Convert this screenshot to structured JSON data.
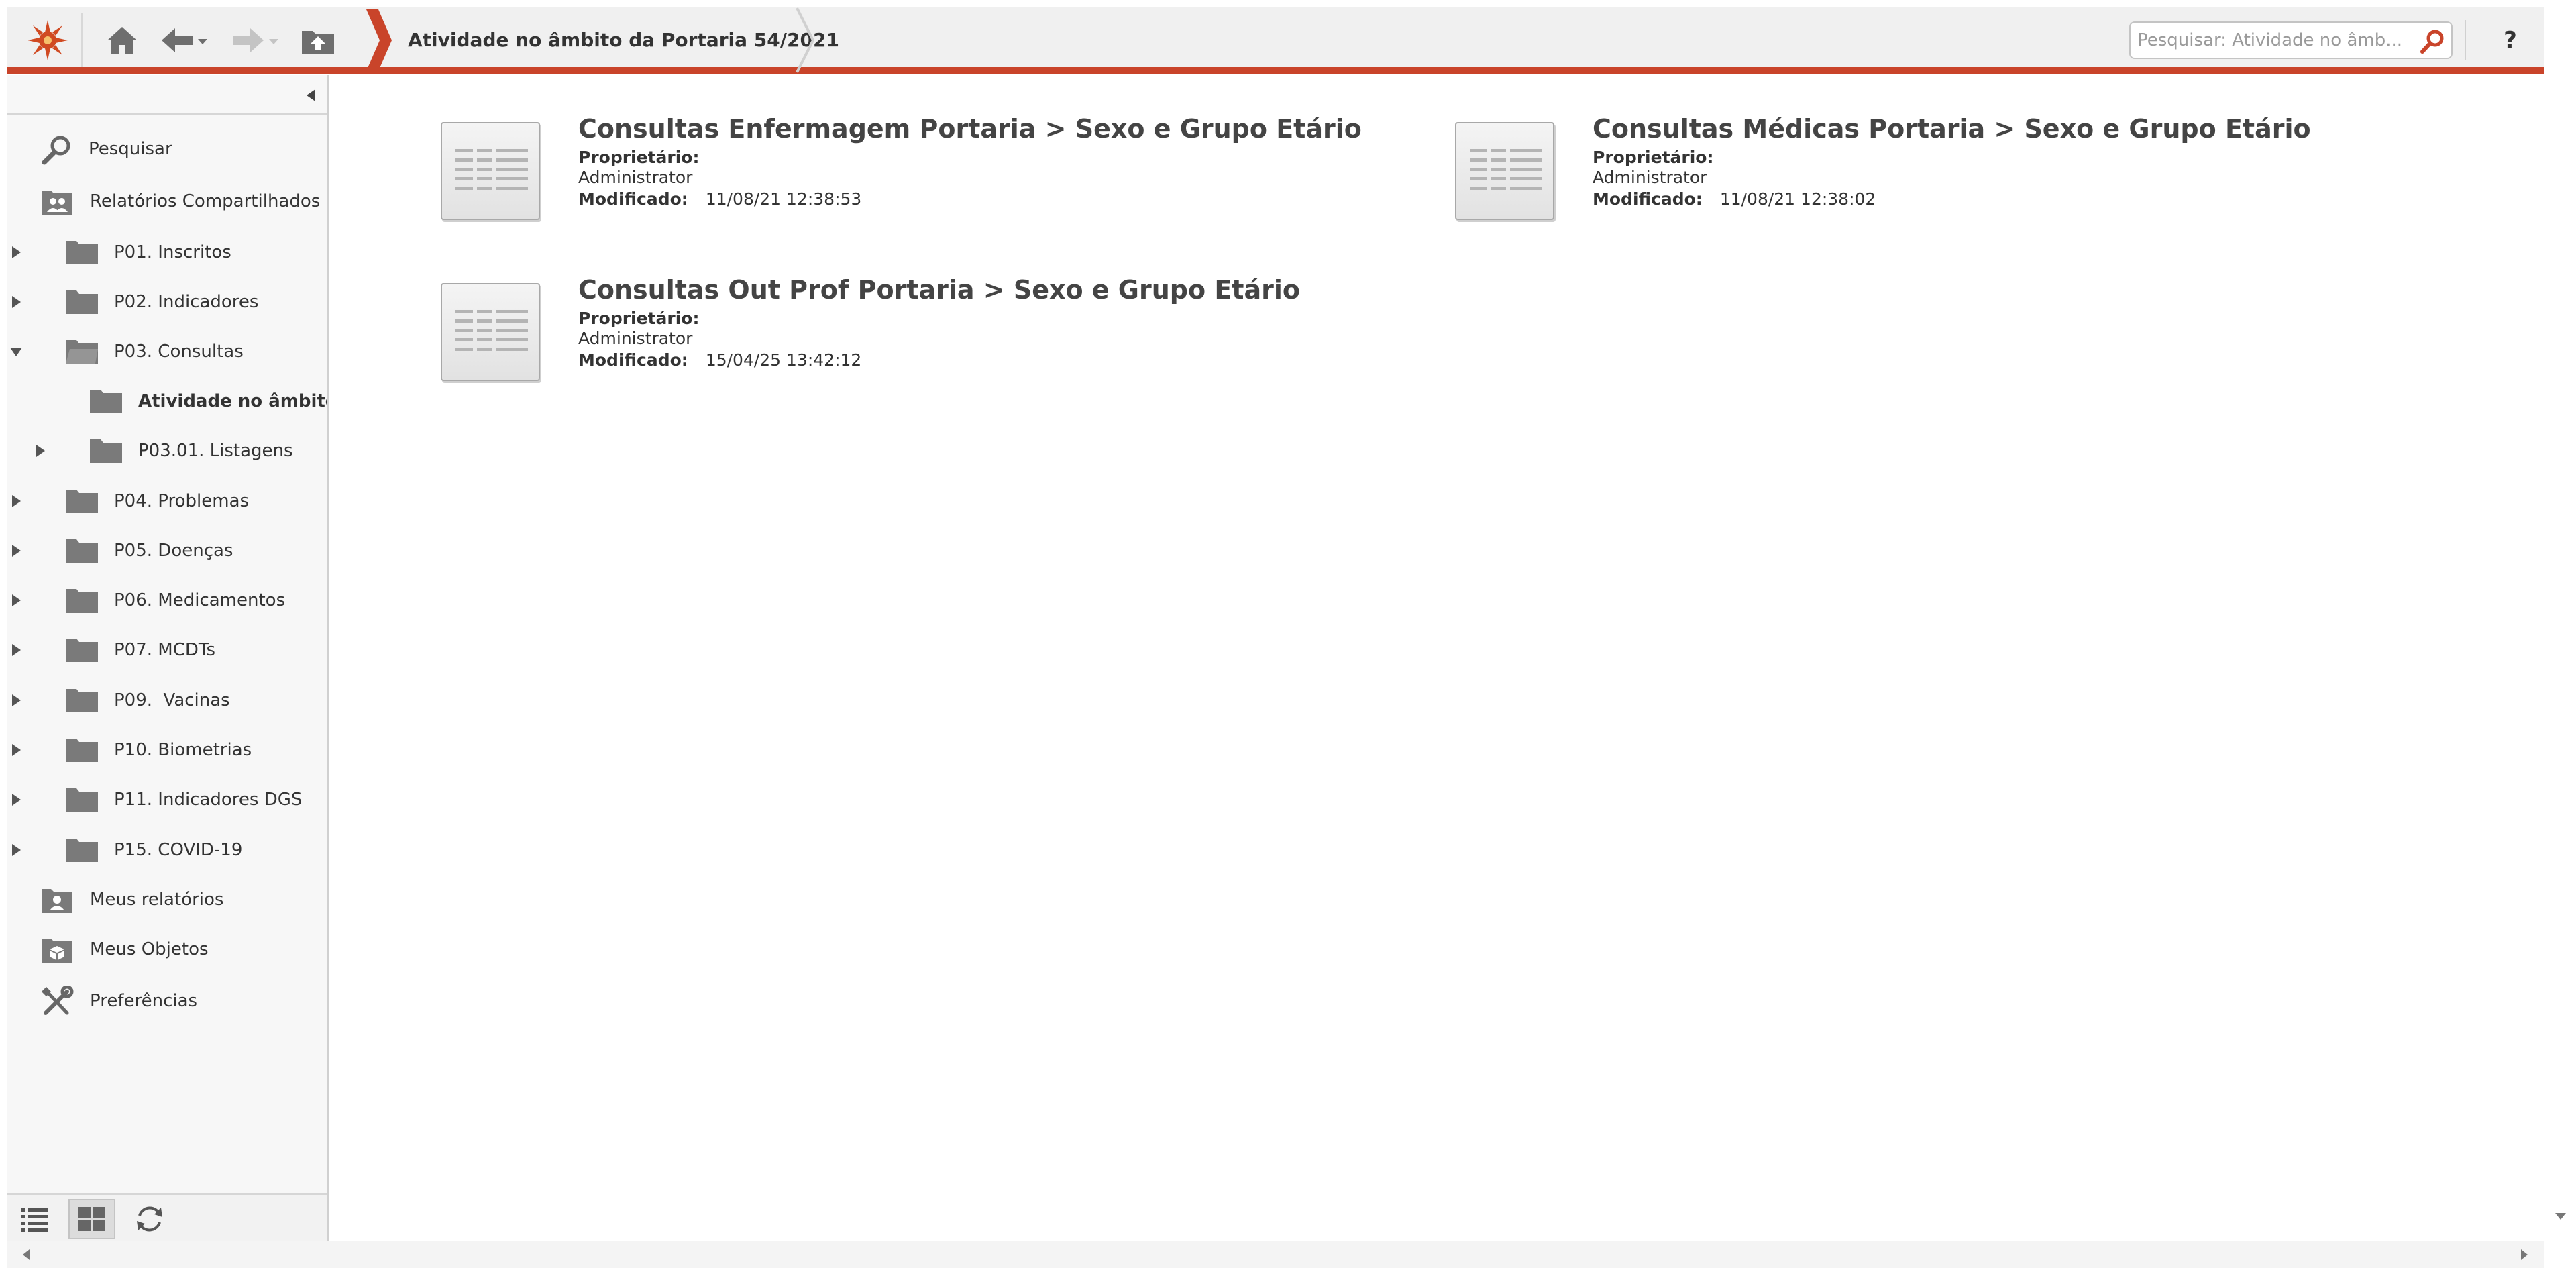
{
  "toolbar": {
    "breadcrumb": "Atividade no âmbito da Portaria 54/2021",
    "search_placeholder": "Pesquisar: Atividade no âmb...",
    "help_label": "?"
  },
  "sidebar": {
    "search_label": "Pesquisar",
    "shared_reports_label": "Relatórios Compartilhados",
    "folders": [
      {
        "label": "P01. Inscritos"
      },
      {
        "label": "P02. Indicadores"
      },
      {
        "label": "P03. Consultas"
      },
      {
        "label": "Atividade no âmbito d"
      },
      {
        "label": "P03.01. Listagens"
      },
      {
        "label": "P04. Problemas"
      },
      {
        "label": "P05. Doenças"
      },
      {
        "label": "P06. Medicamentos"
      },
      {
        "label": "P07. MCDTs"
      },
      {
        "label": "P09.  Vacinas"
      },
      {
        "label": "P10. Biometrias"
      },
      {
        "label": "P11. Indicadores DGS"
      },
      {
        "label": "P15. COVID-19"
      }
    ],
    "my_reports_label": "Meus relatórios",
    "my_objects_label": "Meus Objetos",
    "preferences_label": "Preferências"
  },
  "reports": [
    {
      "title": "Consultas Enfermagem Portaria > Sexo e Grupo Etário",
      "owner_label": "Proprietário:",
      "owner": "Administrator",
      "modified_label": "Modificado:",
      "modified": "11/08/21 12:38:53"
    },
    {
      "title": "Consultas Médicas Portaria > Sexo e Grupo Etário",
      "owner_label": "Proprietário:",
      "owner": "Administrator",
      "modified_label": "Modificado:",
      "modified": "11/08/21 12:38:02"
    },
    {
      "title": "Consultas Out Prof Portaria > Sexo e Grupo Etário",
      "owner_label": "Proprietário:",
      "owner": "Administrator",
      "modified_label": "Modificado:",
      "modified": "15/04/25 13:42:12"
    }
  ],
  "colors": {
    "accent": "#c9442a",
    "logo": "#d04a22",
    "toolbar_bg": "#f0f0f0",
    "sidebar_bg": "#f7f7f7"
  }
}
